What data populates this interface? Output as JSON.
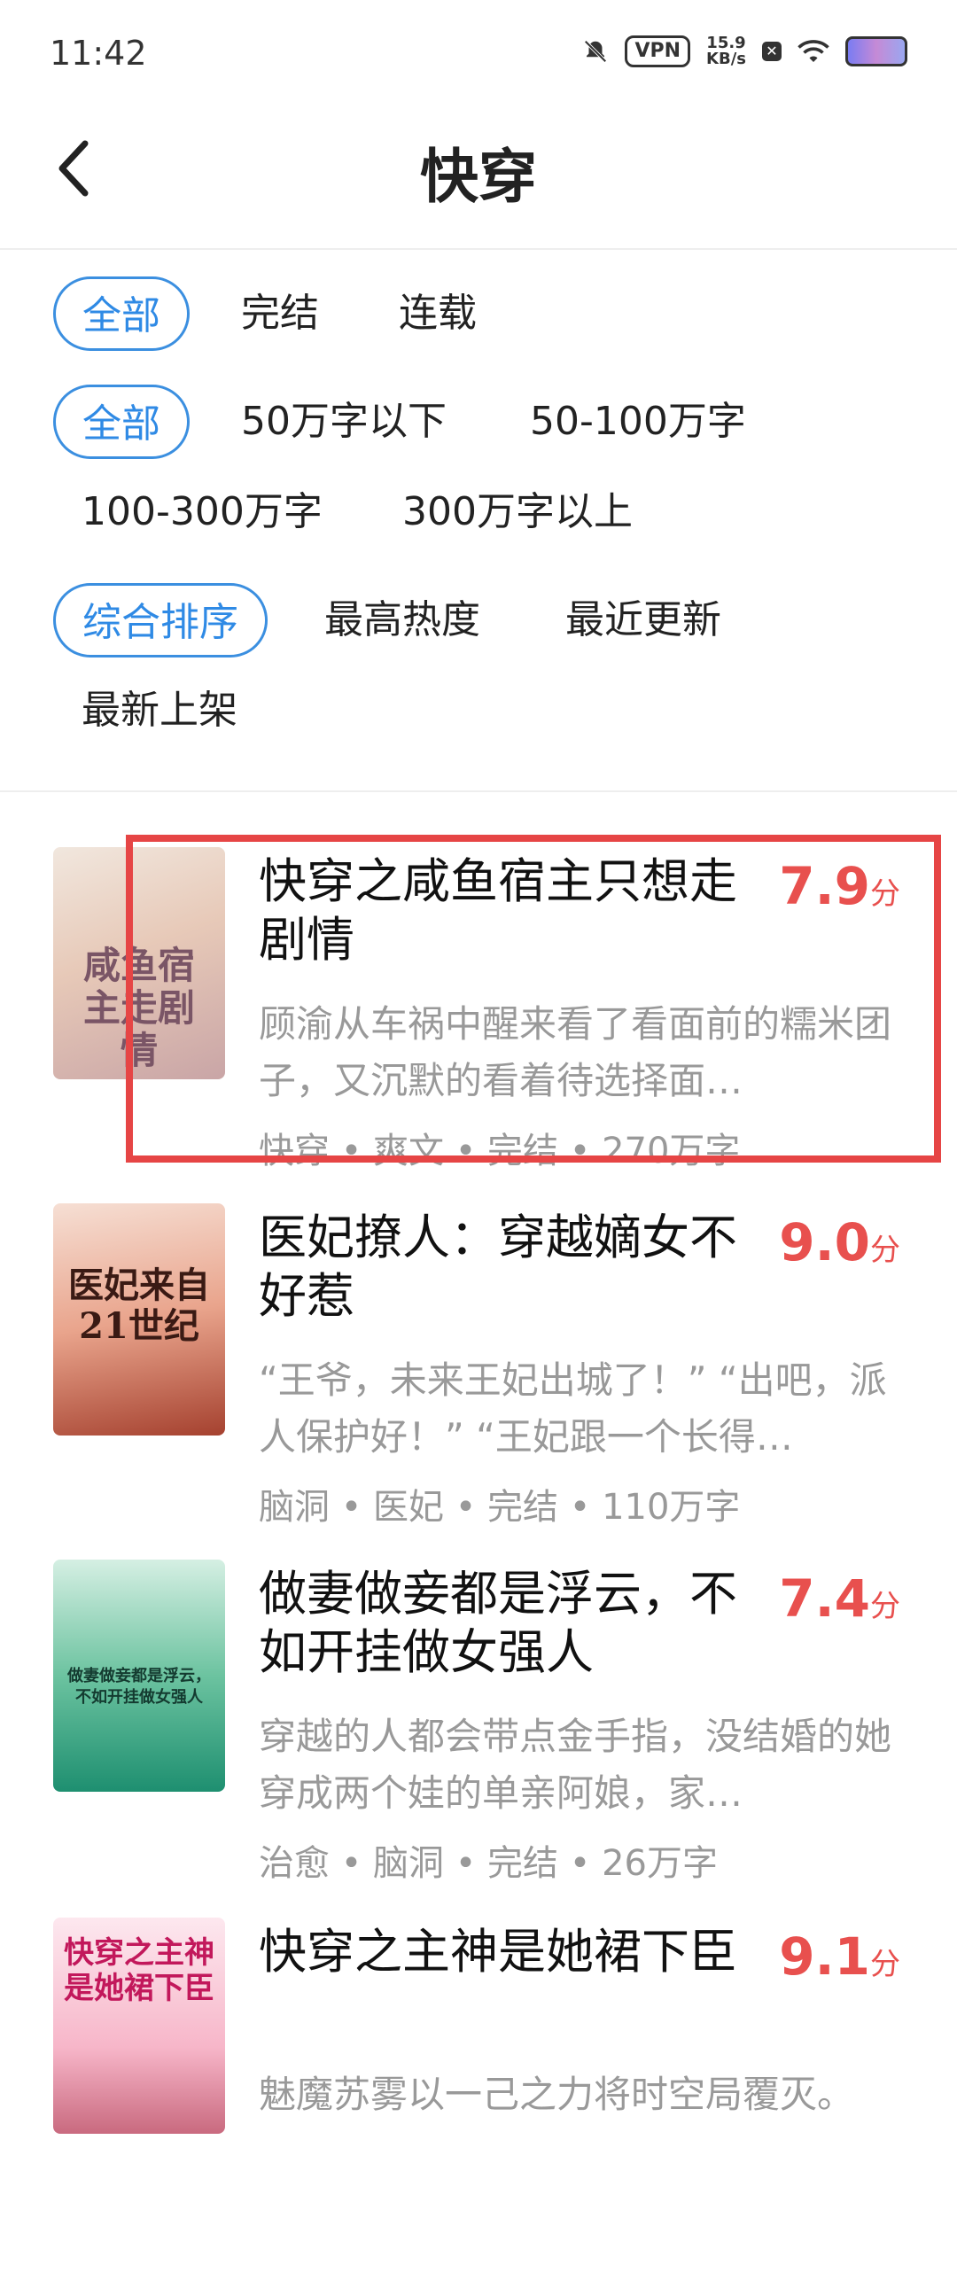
{
  "status_bar": {
    "time": "11:42",
    "vpn": "VPN",
    "speed_value": "15.9",
    "speed_unit": "KB/s",
    "icons": [
      "mute-bell-icon",
      "vpn-icon",
      "network-speed",
      "x-box-icon",
      "wifi-icon",
      "battery-icon"
    ]
  },
  "header": {
    "title": "快穿",
    "back_icon": "chevron-left-icon"
  },
  "filters": {
    "status": [
      "全部",
      "完结",
      "连载"
    ],
    "length": [
      "全部",
      "50万字以下",
      "50-100万字",
      "100-300万字",
      "300万字以上"
    ],
    "sort": [
      "综合排序",
      "最高热度",
      "最近更新",
      "最新上架"
    ],
    "active_color": "#2f8ae5"
  },
  "books": [
    {
      "title": "快穿之咸鱼宿主只想走剧情",
      "score": "7.9",
      "unit": "分",
      "desc": "顾渝从车祸中醒来看了看面前的糯米团子，又沉默的看着待选择面…",
      "meta": "快穿 • 爽文 • 完结 • 270万字",
      "cover_text": "咸鱼宿主走剧情"
    },
    {
      "title": "医妃撩人：穿越嫡女不好惹",
      "score": "9.0",
      "unit": "分",
      "desc": "“王爷，未来王妃出城了！” “出吧，派人保护好！” “王妃跟一个长得…",
      "meta": "脑洞 • 医妃 • 完结 • 110万字",
      "cover_text": "医妃来自21世纪"
    },
    {
      "title": "做妻做妾都是浮云，不如开挂做女强人",
      "score": "7.4",
      "unit": "分",
      "desc": "穿越的人都会带点金手指，没结婚的她穿成两个娃的单亲阿娘，家…",
      "meta": "治愈 • 脑洞 • 完结 • 26万字",
      "cover_text": "做妻做妾都是浮云，不如开挂做女强人"
    },
    {
      "title": "快穿之主神是她裙下臣",
      "score": "9.1",
      "unit": "分",
      "desc": "魅魔苏雾以一己之力将时空局覆灭。",
      "meta": "",
      "cover_text": "快穿之主神是她裙下臣"
    }
  ],
  "colors": {
    "score": "#e8504e",
    "highlight": "#e64545"
  }
}
